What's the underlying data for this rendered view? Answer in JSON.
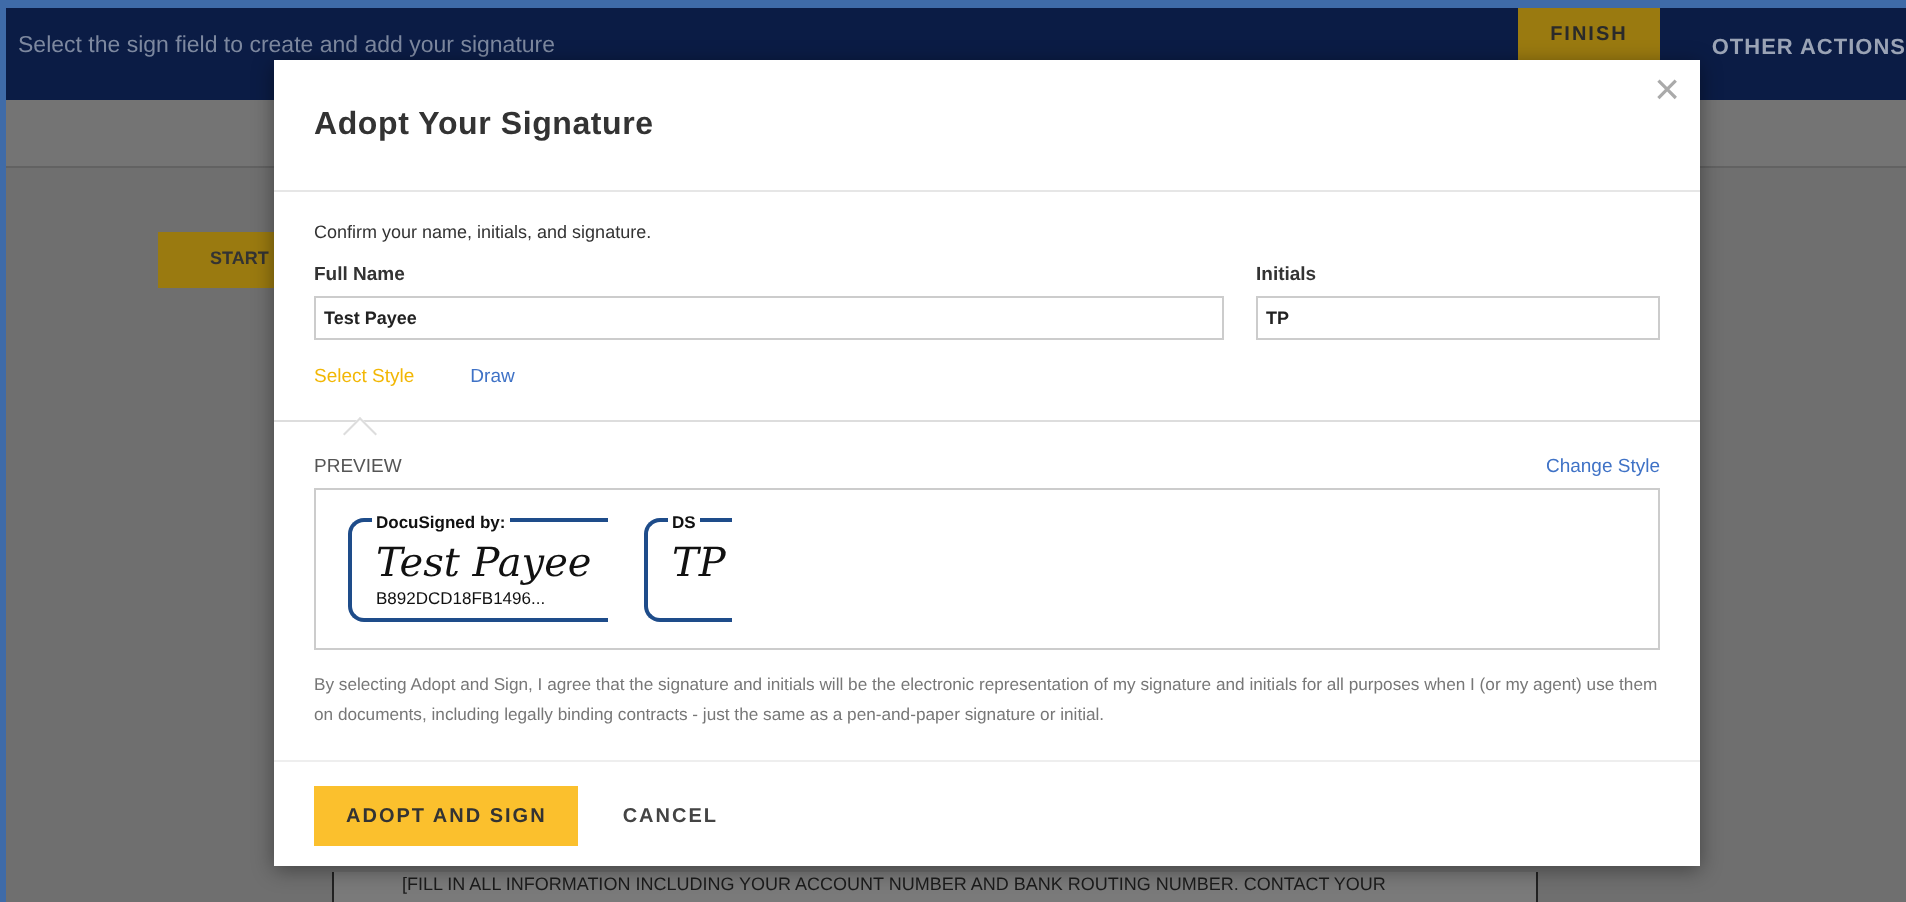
{
  "background": {
    "banner_text": "Select the sign field to create and add your signature",
    "finish_button": "FINISH",
    "other_actions": "OTHER ACTIONS",
    "start_button": "START",
    "document_text": "[FILL IN ALL INFORMATION INCLUDING YOUR ACCOUNT NUMBER AND BANK ROUTING NUMBER. CONTACT YOUR"
  },
  "dialog": {
    "title": "Adopt Your Signature",
    "close": "×",
    "instruction": "Confirm your name, initials, and signature.",
    "full_name": {
      "label": "Full Name",
      "value": "Test Payee"
    },
    "initials": {
      "label": "Initials",
      "value": "TP"
    },
    "tabs": [
      {
        "label": "Select Style",
        "selected": true
      },
      {
        "label": "Draw",
        "selected": false
      }
    ],
    "preview_label": "PREVIEW",
    "change_style": "Change Style",
    "signature": {
      "header": "DocuSigned by:",
      "signature": "Test Payee",
      "id": "B892DCD18FB1496..."
    },
    "initials_stamp": {
      "header": "DS",
      "initials": "TP"
    },
    "disclaimer": "By selecting Adopt and Sign, I agree that the signature and initials will be the electronic representation of my signature and initials for all purposes when I (or my agent) use them on documents, including legally binding contracts - just the same as a pen-and-paper signature or initial.",
    "buttons": [
      {
        "label": "ADOPT AND SIGN",
        "kind": "primary"
      },
      {
        "label": "CANCEL",
        "kind": "link"
      }
    ]
  }
}
